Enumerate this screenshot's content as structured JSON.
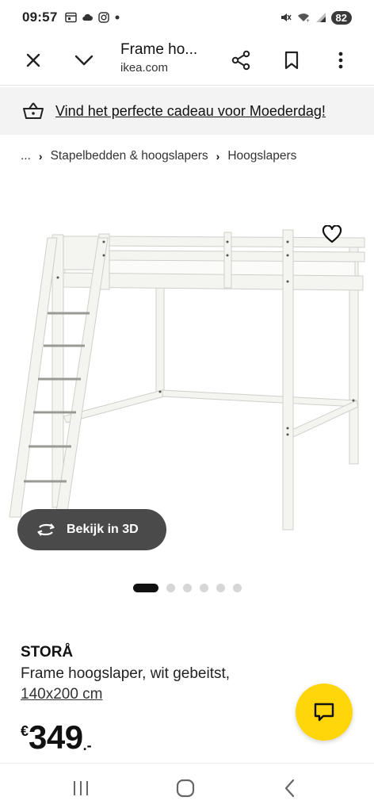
{
  "status_bar": {
    "time": "09:57",
    "battery": "82",
    "left_icons": [
      "calendar-icon",
      "cloud-icon",
      "instagram-icon",
      "dot-icon"
    ],
    "right_icons": [
      "mute-icon",
      "wifi-icon",
      "signal-icon",
      "battery-icon"
    ]
  },
  "toolbar": {
    "title": "Frame ho...",
    "url": "ikea.com"
  },
  "promo": {
    "text": "Vind het perfecte cadeau voor Moederdag!"
  },
  "breadcrumb": {
    "items": [
      "...",
      "Stapelbedden & hoogslapers",
      "Hoogslapers"
    ],
    "separator": "›"
  },
  "media": {
    "view_3d_label": "Bekijk in 3D",
    "carousel": {
      "count": 6,
      "active": 1
    }
  },
  "product": {
    "name": "STORÅ",
    "description": "Frame hoogslaper, wit gebeitst,",
    "size": "140x200 cm",
    "price": {
      "currency": "€",
      "integer": "349",
      "decimal": ".-"
    }
  },
  "colors": {
    "accent_yellow": "#ffd60a",
    "promo_bg": "#f3f3f3",
    "pill_bg": "#4a4a4a"
  }
}
